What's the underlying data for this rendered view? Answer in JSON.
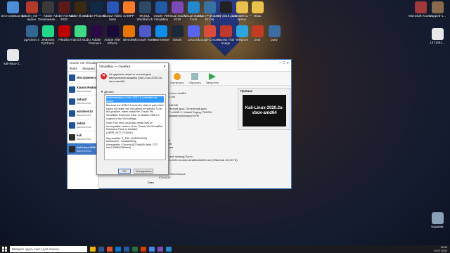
{
  "desktop": {
    "row1": [
      {
        "label": "Этот компьютер",
        "color": "#4a8fd8"
      },
      {
        "label": "baturin_me — ярлык",
        "color": "#b43b2a"
      },
      {
        "label": "Adobe Dreamweav...",
        "color": "#3a3a3a"
      },
      {
        "label": "Adobe Animate 2020",
        "color": "#5a1a1a"
      },
      {
        "label": "Adobe Illustrat...",
        "color": "#3a2a10"
      },
      {
        "label": "Adobe Photosh...",
        "color": "#0e2a44"
      },
      {
        "label": "Movavi Video Suite",
        "color": "#2a56b8"
      },
      {
        "label": "XAMPP",
        "color": "#fb7a24"
      },
      {
        "label": "MySQL Workbench",
        "color": "#2c4a68"
      },
      {
        "label": "Oracle VM VirtualBox",
        "color": "#1f5ba8"
      },
      {
        "label": "Visual Studio 2019",
        "color": "#7a4ab8"
      },
      {
        "label": "Visual Studio Code",
        "color": "#1f8ad2"
      },
      {
        "label": "IDLE (Python 3.7 64-bit)",
        "color": "#3772a4"
      },
      {
        "label": "Unity 2019.2.0f1",
        "color": "#222222"
      },
      {
        "label": "Документы — ярлык",
        "color": "#e8c24a"
      },
      {
        "label": "Игры",
        "color": "#e8c24a"
      },
      {
        "label": "Microsoft Access",
        "color": "#a4373a"
      },
      {
        "label": "cropped-1...",
        "color": "#8a6a4a"
      }
    ],
    "row2": [
      {
        "label": "pgAdmin 4",
        "color": "#336791"
      },
      {
        "label": "JetBrains PyCharm",
        "color": "#21d789"
      },
      {
        "label": "FileZilla",
        "color": "#bf0000"
      },
      {
        "label": "Android Studio",
        "color": "#3ddc84"
      },
      {
        "label": "Adobe Premiere...",
        "color": "#2a0a44"
      },
      {
        "label": "Adobe After Effects",
        "color": "#1a0a3a"
      },
      {
        "label": "Blender",
        "color": "#ea7600"
      },
      {
        "label": "Microsoft Teams",
        "color": "#5059c9"
      },
      {
        "label": "TeamViewer",
        "color": "#0e8ee9"
      },
      {
        "label": "Steam",
        "color": "#1b2838"
      },
      {
        "label": "Discord",
        "color": "#5865f2"
      },
      {
        "label": "Google Chrome",
        "color": "#dd4b39"
      },
      {
        "label": "Access Trial Image",
        "color": "#c0392b"
      },
      {
        "label": "Telegram",
        "color": "#2ca5e0"
      },
      {
        "label": "Zeal",
        "color": "#c23b22"
      },
      {
        "label": "putty",
        "color": "#3a6ea5"
      }
    ],
    "extra": [
      {
        "label": "kali-linux-2...",
        "color": "#e8e8e8"
      },
      {
        "label": "1471651...",
        "color": "#e8e8e8"
      },
      {
        "label": "Корзина",
        "color": "#8aa0b8"
      }
    ]
  },
  "vbox": {
    "title": "Oracle VM VirtualBox Менеджер",
    "menu": [
      "Файл",
      "Машина",
      "Справка"
    ],
    "tools_label": "Инструменты",
    "vms": [
      {
        "name": "Xiaomi Redmi",
        "state": "Выключена"
      },
      {
        "name": "default",
        "state": "Выключена"
      },
      {
        "name": "windows10",
        "state": "Выключена"
      },
      {
        "name": "deb10",
        "state": "Выключена"
      },
      {
        "name": "kali",
        "state": "Выключена"
      },
      {
        "name": "Kali-Linux-2020.2a-vbox-amd64",
        "state": "Выключена"
      }
    ],
    "toolbar": [
      "Настроить",
      "Сбросить",
      "Запустить"
    ],
    "preview_label": "Превью",
    "preview_name": "Kali-Linux-2020.2a-vbox-amd64",
    "details": [
      "2a-vbox-amd64",
      "64-bit)",
      "2048 МБ",
      "Жёсткий диск, Оптический диск",
      "VT-x/AMD-V, Nested Paging, PAE/NX,",
      "Паравиртуализация KVM",
      "128 МБ",
      "VMSVGA",
      "Выключен",
      "Выключена",
      "[Оптический привод] Пусто",
      "Kali-Linux-2020.2a-vbox-amd64-disk001.vdi (Обычный, 80,00 ГБ)",
      "Windows DirectSound",
      "ICH AC97",
      "Сеть"
    ]
  },
  "dialog": {
    "title": "VirtualBox — Ошибка",
    "message": "Не удалось открыть сессию для виртуальной машины Kali-Linux-2020.2a-vbox-amd64.",
    "details_label": "Детали",
    "detail_lines": [
      "Implementation of the USB 2.0 controller not found!",
      "Because the USB 2.0 controller state is part of the saved VM state, the VM cannot be started. To fix this problem, either install the 'Oracle VM VirtualBox Extension Pack' or disable USB 2.0 support in the VM settings.",
      "Note! This error could also mean that an incompatible version of the 'Oracle VM VirtualBox Extension Pack' is installed (VERR_NOT_FOUND).",
      "Код ошибки: E_FAIL (0x80004005)",
      "Компонент: ConsoleWrap",
      "Интерфейс: IConsole {872da645-4a9b-1727-bee2-5585105b9eed}"
    ],
    "ok": "OK",
    "copy": "Копировать"
  },
  "taskbar": {
    "search": "Введите здесь текст для поиска",
    "time": "18:05",
    "date": "14.07.2020",
    "items": [
      "#f0b400",
      "#2b579a",
      "#e34f26",
      "#0078d7",
      "#1f5ba8",
      "#217346",
      "#d83b01",
      "#4285f4",
      "#7a4ab8",
      "#1f8ad2"
    ]
  }
}
